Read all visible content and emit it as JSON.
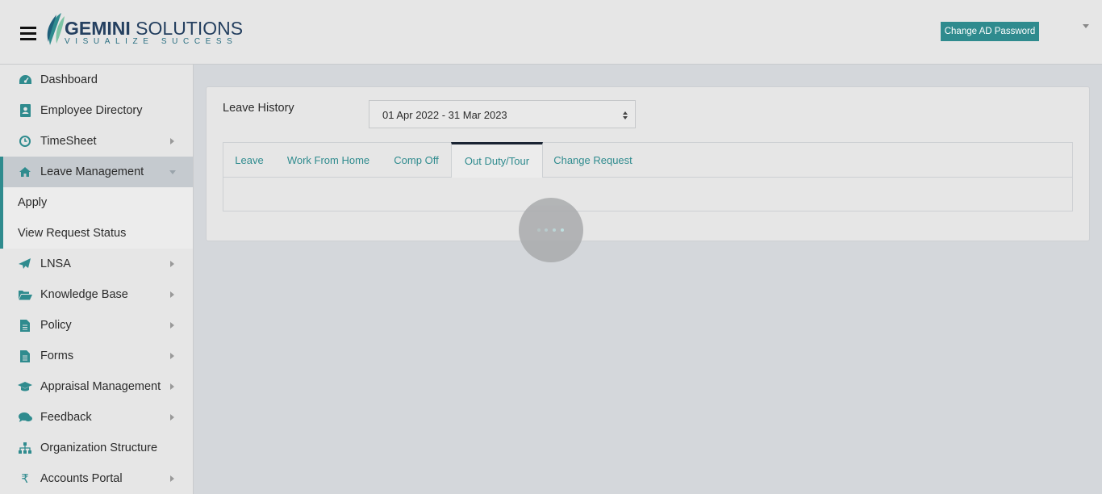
{
  "header": {
    "logo_main_bold": "GEMINI",
    "logo_main_rest": "SOLUTIONS",
    "logo_sub": "VISUALIZE SUCCESS",
    "change_password_label": "Change AD Password"
  },
  "sidebar": {
    "items": [
      {
        "label": "Dashboard",
        "icon": "dashboard-icon",
        "has_arrow": false
      },
      {
        "label": "Employee Directory",
        "icon": "contact-book-icon",
        "has_arrow": false
      },
      {
        "label": "TimeSheet",
        "icon": "clock-icon",
        "has_arrow": true
      },
      {
        "label": "Leave Management",
        "icon": "home-icon",
        "expanded": true
      },
      {
        "label": "LNSA",
        "icon": "send-icon",
        "has_arrow": true
      },
      {
        "label": "Knowledge Base",
        "icon": "folder-open-icon",
        "has_arrow": true
      },
      {
        "label": "Policy",
        "icon": "document-icon",
        "has_arrow": true
      },
      {
        "label": "Forms",
        "icon": "document-icon",
        "has_arrow": true
      },
      {
        "label": "Appraisal Management",
        "icon": "graduation-cap-icon",
        "has_arrow": true
      },
      {
        "label": "Feedback",
        "icon": "comments-icon",
        "has_arrow": true
      },
      {
        "label": "Organization Structure",
        "icon": "sitemap-icon",
        "has_arrow": false
      },
      {
        "label": "Accounts Portal",
        "icon": "rupee-icon",
        "has_arrow": true
      }
    ],
    "sub_items": [
      "Apply",
      "View Request Status"
    ]
  },
  "main": {
    "title": "Leave History",
    "period_selected": "01 Apr 2022 - 31 Mar 2023",
    "tabs": [
      "Leave",
      "Work From Home",
      "Comp Off",
      "Out Duty/Tour",
      "Change Request"
    ],
    "active_tab": "Out Duty/Tour"
  },
  "colors": {
    "accent": "#2f8b8e",
    "header_bg": "#e6e6e6",
    "active_tab_border": "#1a2433"
  }
}
